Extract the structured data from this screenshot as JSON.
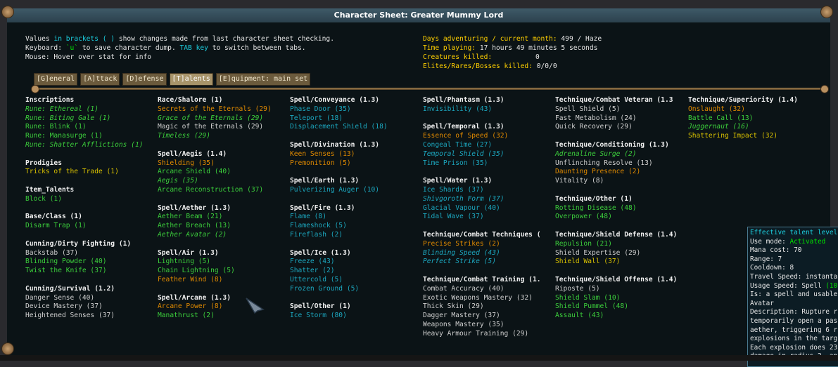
{
  "window": {
    "title": "Character Sheet: Greater Mummy Lord"
  },
  "info": {
    "line1": {
      "a": "Values ",
      "b": "in brackets ( )",
      "c": " show changes made from last character sheet checking."
    },
    "line2": {
      "a": "Keyboard: ",
      "b": "`u`",
      "c": " to save character dump. ",
      "d": "TAB key",
      "e": " to switch between tabs."
    },
    "line3": "Mouse: Hover over stat for info",
    "days_label": "Days adventuring / current month:",
    "days_value": "499 / Haze",
    "time_label": "Time playing:",
    "time_value": "17 hours 49 minutes 5 seconds",
    "creatures_label": "Creatures killed:",
    "creatures_value": "0",
    "elites_label": "Elites/Rares/Bosses killed:",
    "elites_value": "0/0/0"
  },
  "tabs": [
    "[G]eneral",
    "[A]ttack",
    "[D]efense",
    "[T]alents",
    "[E]quipment: main set"
  ],
  "columns": [
    {
      "categories": [
        {
          "name": "Inscriptions",
          "items": [
            [
              "Rune: Ethereal (1)",
              "g",
              1
            ],
            [
              "Rune: Biting Gale (1)",
              "g",
              1
            ],
            [
              "Rune: Blink (1)",
              "g",
              0
            ],
            [
              "Rune: Manasurge (1)",
              "g",
              0
            ],
            [
              "Rune: Shatter Afflictions (1)",
              "g",
              1
            ]
          ]
        },
        {
          "name": "Prodigies",
          "items": [
            [
              "Tricks of the Trade (1)",
              "y",
              0
            ]
          ]
        },
        {
          "name": "Item_Talents",
          "items": [
            [
              "Block (1)",
              "g",
              0
            ]
          ]
        },
        {
          "name": "Base/Class (1)",
          "items": [
            [
              "Disarm Trap (1)",
              "g",
              0
            ]
          ]
        },
        {
          "name": "Cunning/Dirty Fighting (1)",
          "items": [
            [
              "Backstab (37)",
              "w",
              0
            ],
            [
              "Blinding Powder (40)",
              "g",
              0
            ],
            [
              "Twist the Knife (37)",
              "g",
              0
            ]
          ]
        },
        {
          "name": "Cunning/Survival (1.2)",
          "items": [
            [
              "Danger Sense (40)",
              "w",
              0
            ],
            [
              "Device Mastery (37)",
              "w",
              0
            ],
            [
              "Heightened Senses (37)",
              "w",
              0
            ]
          ]
        }
      ]
    },
    {
      "categories": [
        {
          "name": "Race/Shalore (1)",
          "items": [
            [
              "Secrets of the Eternals (29)",
              "o",
              0
            ],
            [
              "Grace of the Eternals (29)",
              "g",
              1
            ],
            [
              "Magic of the Eternals (29)",
              "w",
              0
            ],
            [
              "Timeless (29)",
              "g",
              1
            ]
          ]
        },
        {
          "name": "Spell/Aegis (1.4)",
          "items": [
            [
              "Shielding (35)",
              "o",
              0
            ],
            [
              "Arcane Shield (40)",
              "g",
              0
            ],
            [
              "Aegis (35)",
              "g",
              1
            ],
            [
              "Arcane Reconstruction (37)",
              "g",
              0
            ]
          ]
        },
        {
          "name": "Spell/Aether (1.3)",
          "items": [
            [
              "Aether Beam (21)",
              "g",
              0
            ],
            [
              "Aether Breach (13)",
              "g",
              0
            ],
            [
              "Aether Avatar (2)",
              "g",
              1
            ]
          ]
        },
        {
          "name": "Spell/Air (1.3)",
          "items": [
            [
              "Lightning (5)",
              "g",
              0
            ],
            [
              "Chain Lightning (5)",
              "g",
              0
            ],
            [
              "Feather Wind (8)",
              "o",
              0
            ]
          ]
        },
        {
          "name": "Spell/Arcane (1.3)",
          "items": [
            [
              "Arcane Power (8)",
              "o",
              0
            ],
            [
              "Manathrust (2)",
              "g",
              0
            ]
          ]
        }
      ]
    },
    {
      "categories": [
        {
          "name": "Spell/Conveyance (1.3)",
          "items": [
            [
              "Phase Door (35)",
              "c",
              0
            ],
            [
              "Teleport (18)",
              "c",
              0
            ],
            [
              "Displacement Shield (18)",
              "c",
              0
            ]
          ]
        },
        {
          "name": "Spell/Divination (1.3)",
          "items": [
            [
              "Keen Senses (13)",
              "o",
              0
            ],
            [
              "Premonition (5)",
              "o",
              0
            ]
          ]
        },
        {
          "name": "Spell/Earth (1.3)",
          "items": [
            [
              "Pulverizing Auger (10)",
              "c",
              0
            ]
          ]
        },
        {
          "name": "Spell/Fire (1.3)",
          "items": [
            [
              "Flame (8)",
              "c",
              0
            ],
            [
              "Flameshock (5)",
              "c",
              0
            ],
            [
              "Fireflash (2)",
              "c",
              0
            ]
          ]
        },
        {
          "name": "Spell/Ice (1.3)",
          "items": [
            [
              "Freeze (43)",
              "c",
              0
            ],
            [
              "Shatter (2)",
              "c",
              0
            ],
            [
              "Uttercold (5)",
              "c",
              0
            ],
            [
              "Frozen Ground (5)",
              "c",
              0
            ]
          ]
        },
        {
          "name": "Spell/Other (1)",
          "items": [
            [
              "Ice Storm (80)",
              "c",
              0
            ]
          ]
        }
      ]
    },
    {
      "categories": [
        {
          "name": "Spell/Phantasm (1.3)",
          "items": [
            [
              "Invisibility (43)",
              "c",
              0
            ]
          ]
        },
        {
          "name": "Spell/Temporal (1.3)",
          "items": [
            [
              "Essence of Speed (32)",
              "o",
              0
            ],
            [
              "Congeal Time (27)",
              "c",
              0
            ],
            [
              "Temporal Shield (35)",
              "c",
              1
            ],
            [
              "Time Prison (35)",
              "c",
              0
            ]
          ]
        },
        {
          "name": "Spell/Water (1.3)",
          "items": [
            [
              "Ice Shards (37)",
              "c",
              0
            ],
            [
              "Shivgoroth Form (37)",
              "c",
              1
            ],
            [
              "Glacial Vapour (40)",
              "c",
              0
            ],
            [
              "Tidal Wave (37)",
              "c",
              0
            ]
          ]
        },
        {
          "name": "Technique/Combat Techniques (",
          "items": [
            [
              "Precise Strikes (2)",
              "o",
              0
            ],
            [
              "Blinding Speed (43)",
              "c",
              1
            ],
            [
              "Perfect Strike (5)",
              "c",
              1
            ]
          ]
        },
        {
          "name": "Technique/Combat Training (1.",
          "items": [
            [
              "Combat Accuracy (40)",
              "w",
              0
            ],
            [
              "Exotic Weapons Mastery (32)",
              "w",
              0
            ],
            [
              "Thick Skin (29)",
              "w",
              0
            ],
            [
              "Dagger Mastery (37)",
              "w",
              0
            ],
            [
              "Weapons Mastery (35)",
              "w",
              0
            ],
            [
              "Heavy Armour Training (29)",
              "w",
              0
            ]
          ]
        }
      ]
    },
    {
      "categories": [
        {
          "name": "Technique/Combat Veteran (1.3",
          "items": [
            [
              "Spell Shield (5)",
              "w",
              0
            ],
            [
              "Fast Metabolism (24)",
              "w",
              0
            ],
            [
              "Quick Recovery (29)",
              "w",
              0
            ]
          ]
        },
        {
          "name": "Technique/Conditioning (1.3)",
          "items": [
            [
              "Adrenaline Surge (2)",
              "g",
              1
            ],
            [
              "Unflinching Resolve (13)",
              "w",
              0
            ],
            [
              "Daunting Presence (2)",
              "o",
              0
            ],
            [
              "Vitality (8)",
              "w",
              0
            ]
          ]
        },
        {
          "name": "Technique/Other (1)",
          "items": [
            [
              "Rotting Disease (48)",
              "g",
              0
            ],
            [
              "Overpower (48)",
              "g",
              0
            ]
          ]
        },
        {
          "name": "Technique/Shield Defense (1.4)",
          "items": [
            [
              "Repulsion (21)",
              "g",
              0
            ],
            [
              "Shield Expertise (29)",
              "w",
              0
            ],
            [
              "Shield Wall (37)",
              "y",
              0
            ]
          ]
        },
        {
          "name": "Technique/Shield Offense (1.4)",
          "items": [
            [
              "Riposte (5)",
              "w",
              0
            ],
            [
              "Shield Slam (10)",
              "g",
              0
            ],
            [
              "Shield Pummel (48)",
              "g",
              0
            ],
            [
              "Assault (43)",
              "g",
              0
            ]
          ]
        }
      ]
    },
    {
      "categories": [
        {
          "name": "Technique/Superiority (1.4)",
          "items": [
            [
              "Onslaught (32)",
              "o",
              0
            ],
            [
              "Battle Call (13)",
              "g",
              0
            ],
            [
              "Juggernaut (16)",
              "g",
              1
            ],
            [
              "Shattering Impact (32)",
              "y",
              0
            ]
          ]
        }
      ]
    }
  ],
  "tooltip": {
    "l1": "Effective talent level",
    "l2a": "Use mode: ",
    "l2b": "Activated",
    "l3": "Mana cost: 70",
    "l4": "Range: 7",
    "l5": "Cooldown: 8",
    "l6": "Travel Speed: instanta",
    "l7a": "Usage Speed: Spell ",
    "l7b": "(10",
    "l8": "Is: a spell and usable",
    "l9": "Avatar",
    "l10": "Description: Rupture r",
    "l11": "temporarily open a pas",
    "l12": "aether, triggering 6 r",
    "l13": "explosions in the targ",
    "l14": "Each explosion does 23",
    "l15": "damage in radius 2, an"
  },
  "colors": {
    "title_bg": "#3e5a68",
    "panel_bg": "#0b1316",
    "tab_bg": "#6b5a3c",
    "tab_active_bg": "#a8946a",
    "cyan": "#1ca8c0",
    "green": "#3ccf3c",
    "orange": "#e08a00",
    "yellow": "#d8c000"
  },
  "icons": {
    "corner": "ornament-corner-icon",
    "gem": "character-portrait-gem-icon",
    "cursor": "mouse-cursor-icon"
  }
}
